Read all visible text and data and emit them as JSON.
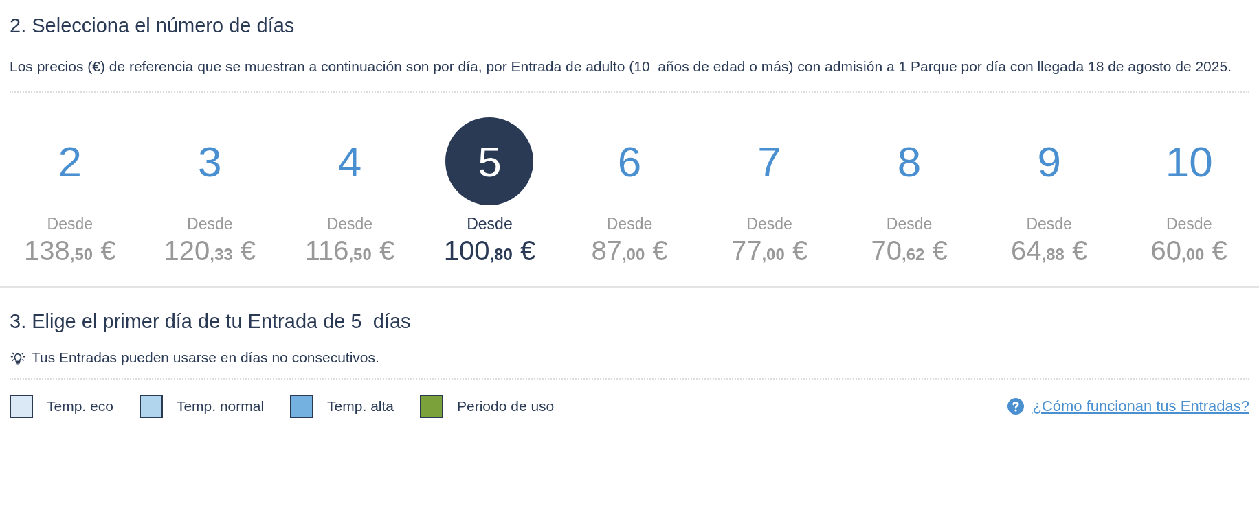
{
  "step_days": {
    "title": "2. Selecciona el número de días",
    "description": "Los precios (€) de referencia que se muestran a continuación son por día, por Entrada de adulto (10  años de edad o más) con admisión a 1 Parque por día con llegada 18 de agosto de 2025.",
    "options": [
      {
        "days": "2",
        "caption": "Desde",
        "price_whole": "138",
        "price_cents": ",50",
        "currency": "€",
        "selected": false
      },
      {
        "days": "3",
        "caption": "Desde",
        "price_whole": "120",
        "price_cents": ",33",
        "currency": "€",
        "selected": false
      },
      {
        "days": "4",
        "caption": "Desde",
        "price_whole": "116",
        "price_cents": ",50",
        "currency": "€",
        "selected": false
      },
      {
        "days": "5",
        "caption": "Desde",
        "price_whole": "100",
        "price_cents": ",80",
        "currency": "€",
        "selected": true
      },
      {
        "days": "6",
        "caption": "Desde",
        "price_whole": "87",
        "price_cents": ",00",
        "currency": "€",
        "selected": false
      },
      {
        "days": "7",
        "caption": "Desde",
        "price_whole": "77",
        "price_cents": ",00",
        "currency": "€",
        "selected": false
      },
      {
        "days": "8",
        "caption": "Desde",
        "price_whole": "70",
        "price_cents": ",62",
        "currency": "€",
        "selected": false
      },
      {
        "days": "9",
        "caption": "Desde",
        "price_whole": "64",
        "price_cents": ",88",
        "currency": "€",
        "selected": false
      },
      {
        "days": "10",
        "caption": "Desde",
        "price_whole": "60",
        "price_cents": ",00",
        "currency": "€",
        "selected": false
      }
    ]
  },
  "step_start": {
    "title": "3. Elige el primer día de tu Entrada de 5  días",
    "tip": "Tus Entradas pueden usarse en días no consecutivos.",
    "legend": [
      {
        "label": "Temp. eco",
        "color": "#dbe9f6"
      },
      {
        "label": "Temp. normal",
        "color": "#b2d5ee"
      },
      {
        "label": "Temp. alta",
        "color": "#75b1e0"
      },
      {
        "label": "Periodo de uso",
        "color": "#7aa13a"
      }
    ],
    "help_link": "¿Cómo funcionan tus Entradas?"
  }
}
